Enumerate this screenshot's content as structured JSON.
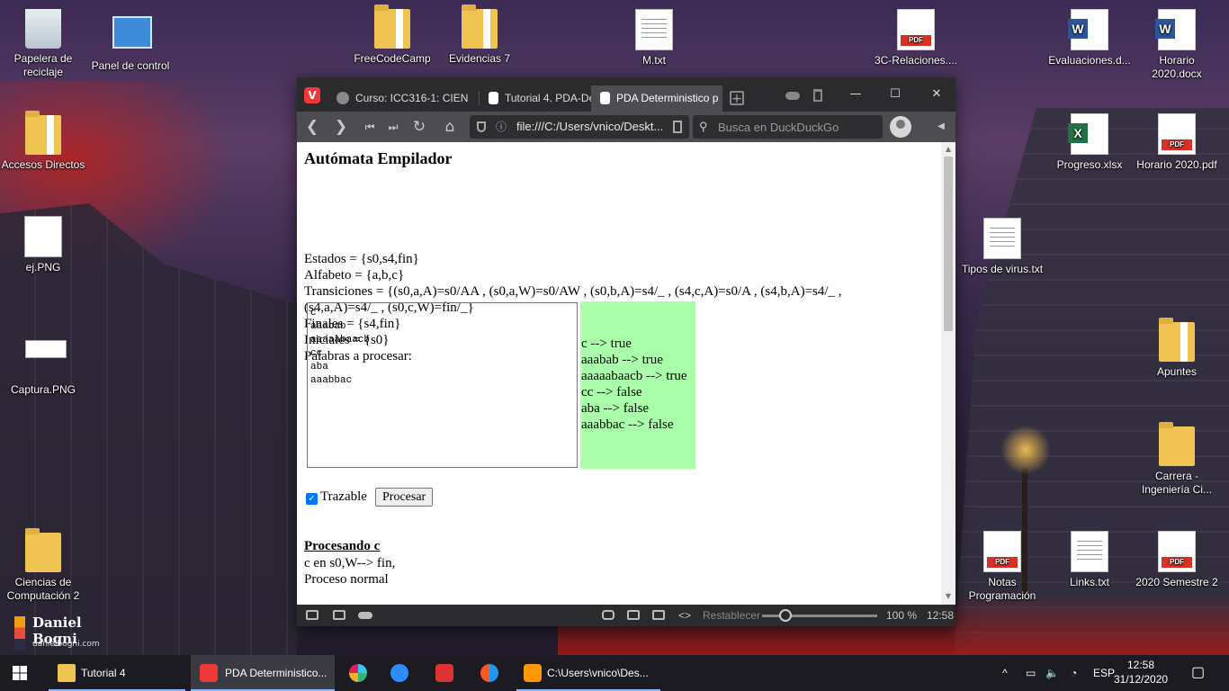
{
  "desktop": {
    "left_icons": [
      {
        "label": "Papelera de reciclaje",
        "icon": "recycle-bin-icon"
      },
      {
        "label": "Panel de control",
        "icon": "control-panel-icon"
      },
      {
        "label": "Accesos Directos",
        "icon": "folder-icon"
      },
      {
        "label": "ej.PNG",
        "icon": "image-file-icon"
      },
      {
        "label": "Captura.PNG",
        "icon": "image-file-icon"
      },
      {
        "label": "Ciencias de Computación 2",
        "icon": "folder-icon"
      }
    ],
    "top_icons": [
      {
        "label": "FreeCodeCamp",
        "icon": "folder-icon"
      },
      {
        "label": "Evidencias 7",
        "icon": "folder-icon"
      },
      {
        "label": "M.txt",
        "icon": "text-file-icon"
      },
      {
        "label": "3C-Relaciones....",
        "icon": "pdf-icon"
      },
      {
        "label": "Evaluaciones.d...",
        "icon": "word-icon"
      },
      {
        "label": "Horario 2020.docx",
        "icon": "word-icon"
      }
    ],
    "right_icons": [
      {
        "label": "Progreso.xlsx",
        "icon": "excel-icon"
      },
      {
        "label": "Horario 2020.pdf",
        "icon": "pdf-icon"
      },
      {
        "label": "Tipos de virus.txt",
        "icon": "text-file-icon"
      },
      {
        "label": "Apuntes",
        "icon": "folder-icon"
      },
      {
        "label": "Carrera - Ingeniería Ci...",
        "icon": "folder-icon"
      },
      {
        "label": "Notas Programación",
        "icon": "pdf-icon"
      },
      {
        "label": "Links.txt",
        "icon": "text-file-icon"
      },
      {
        "label": "2020 Semestre 2",
        "icon": "pdf-icon"
      }
    ],
    "logo": {
      "name": "Daniel Bogni",
      "url": "danielbogni.com"
    }
  },
  "browser": {
    "tabs": [
      {
        "label": "Curso: ICC316-1: CIEN",
        "active": false
      },
      {
        "label": "Tutorial 4. PDA-Deter",
        "active": false
      },
      {
        "label": "PDA Deterministico p",
        "active": true
      }
    ],
    "address": "file:///C:/Users/vnico/Deskt...",
    "search_placeholder": "Busca en DuckDuckGo",
    "status": {
      "reset_label": "Restablecer",
      "zoom": "100 %",
      "time": "12:58",
      "zoom_level": 0.17
    }
  },
  "page": {
    "title": "Autómata Empilador",
    "estados": "Estados = {s0,s4,fin}",
    "alfabeto": "Alfabeto = {a,b,c}",
    "transiciones_1": "Transiciones = {(s0,a,A)=s0/AA , (s0,a,W)=s0/AW , (s0,b,A)=s4/_ , (s4,c,A)=s0/A , (s4,b,A)=s4/_ ,",
    "transiciones_2": "(s4,a,A)=s4/_ , (s0,c,W)=fin/_}",
    "finales": "Finales = {s4,fin}",
    "iniciales": "Iniciales = {s0}",
    "palabras_label": "Palabras a procesar:",
    "palabras": "c\naaabab\naaaaabaacb\ncc\naba\naaabbac",
    "results": [
      "c --> true",
      "aaabab --> true",
      "aaaaabaacb --> true",
      "cc --> false",
      "aba --> false",
      "aaabbac --> false"
    ],
    "trazable_label": "Trazable",
    "procesar_label": "Procesar",
    "procesando_title": "Procesando c",
    "trace_1": "c en s0,W--> fin,",
    "trace_2": "Proceso normal"
  },
  "taskbar": {
    "items": [
      {
        "label": "Tutorial 4",
        "icon": "folder-icon"
      },
      {
        "label": "PDA Deterministico...",
        "icon": "vivaldi-icon"
      },
      {
        "label": "",
        "icon": "slack-icon"
      },
      {
        "label": "",
        "icon": "zoom-icon"
      },
      {
        "label": "",
        "icon": "download-icon"
      },
      {
        "label": "",
        "icon": "app-icon"
      },
      {
        "label": "C:\\Users\\vnico\\Des...",
        "icon": "sublime-text-icon"
      }
    ],
    "lang": "ESP",
    "time": "12:58",
    "date": "31/12/2020"
  }
}
